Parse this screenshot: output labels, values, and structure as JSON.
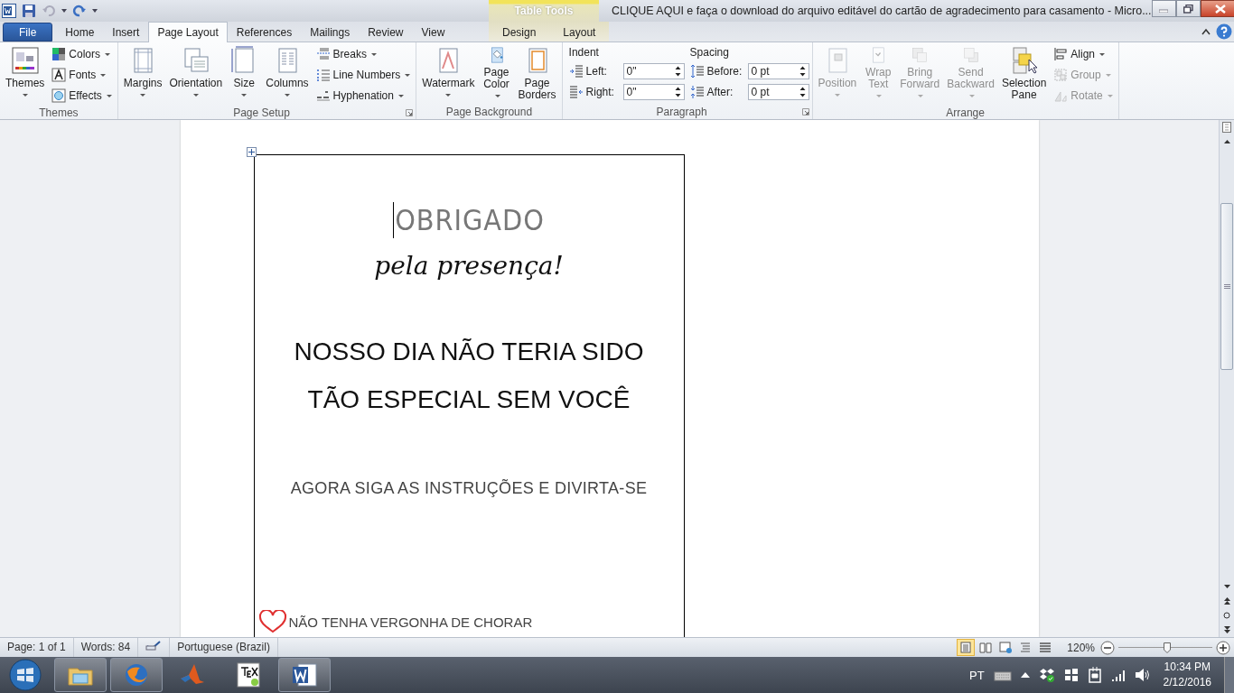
{
  "window": {
    "title": "CLIQUE AQUI e faça o download do arquivo editável do cartão de agradecimento para casamento - Micro...",
    "context_group": "Table Tools"
  },
  "tabs": [
    {
      "label": "File",
      "kind": "file",
      "selected": false
    },
    {
      "label": "Home",
      "kind": "main",
      "selected": false
    },
    {
      "label": "Insert",
      "kind": "main",
      "selected": false
    },
    {
      "label": "Page Layout",
      "kind": "main",
      "selected": true
    },
    {
      "label": "References",
      "kind": "main",
      "selected": false
    },
    {
      "label": "Mailings",
      "kind": "main",
      "selected": false
    },
    {
      "label": "Review",
      "kind": "main",
      "selected": false
    },
    {
      "label": "View",
      "kind": "main",
      "selected": false
    },
    {
      "label": "Design",
      "kind": "contextual",
      "selected": false
    },
    {
      "label": "Layout",
      "kind": "contextual",
      "selected": false
    }
  ],
  "ribbon": {
    "groups": [
      {
        "label": "Themes",
        "launcher": false,
        "columns": [
          [
            {
              "kind": "large",
              "label": "Themes",
              "dropdown": true,
              "disabled": false
            }
          ],
          [
            {
              "kind": "small",
              "label": "Colors",
              "dropdown": true,
              "disabled": false
            },
            {
              "kind": "small",
              "label": "Fonts",
              "dropdown": true,
              "disabled": false
            },
            {
              "kind": "small",
              "label": "Effects",
              "dropdown": true,
              "disabled": false
            }
          ]
        ]
      },
      {
        "label": "Page Setup",
        "launcher": true,
        "columns": [
          [
            {
              "kind": "large",
              "label": "Margins",
              "dropdown": true,
              "disabled": false
            }
          ],
          [
            {
              "kind": "large",
              "label": "Orientation",
              "dropdown": true,
              "disabled": false
            }
          ],
          [
            {
              "kind": "large",
              "label": "Size",
              "dropdown": true,
              "disabled": false
            }
          ],
          [
            {
              "kind": "large",
              "label": "Columns",
              "dropdown": true,
              "disabled": false
            }
          ],
          [
            {
              "kind": "small",
              "label": "Breaks",
              "dropdown": true,
              "disabled": false
            },
            {
              "kind": "small",
              "label": "Line Numbers",
              "dropdown": true,
              "disabled": false
            },
            {
              "kind": "small",
              "label": "Hyphenation",
              "dropdown": true,
              "disabled": false
            }
          ]
        ]
      },
      {
        "label": "Page Background",
        "launcher": false,
        "columns": [
          [
            {
              "kind": "large",
              "label": "Watermark",
              "dropdown": true,
              "disabled": false
            }
          ],
          [
            {
              "kind": "wrap",
              "label": "Page Color",
              "dropdown": true,
              "disabled": false
            }
          ],
          [
            {
              "kind": "wrap",
              "label": "Page Borders",
              "dropdown": false,
              "disabled": false
            }
          ]
        ]
      },
      {
        "label": "Paragraph",
        "launcher": true,
        "columns": [
          [
            {
              "kind": "heading",
              "label": "Indent"
            },
            {
              "kind": "spinner",
              "label": "Left:",
              "value": "0\"",
              "disabled": false
            },
            {
              "kind": "spinner",
              "label": "Right:",
              "value": "0\"",
              "disabled": false
            }
          ],
          [
            {
              "kind": "heading",
              "label": "Spacing"
            },
            {
              "kind": "spinner",
              "label": "Before:",
              "value": "0 pt",
              "disabled": false
            },
            {
              "kind": "spinner",
              "label": "After:",
              "value": "0 pt",
              "disabled": false
            }
          ]
        ]
      },
      {
        "label": "Arrange",
        "launcher": false,
        "columns": [
          [
            {
              "kind": "large",
              "label": "Position",
              "dropdown": true,
              "disabled": true
            }
          ],
          [
            {
              "kind": "wrap",
              "label": "Wrap Text",
              "dropdown": true,
              "disabled": true
            }
          ],
          [
            {
              "kind": "wrap",
              "label": "Bring Forward",
              "dropdown": true,
              "disabled": true
            }
          ],
          [
            {
              "kind": "wrap",
              "label": "Send Backward",
              "dropdown": true,
              "disabled": true
            }
          ],
          [
            {
              "kind": "wrap",
              "label": "Selection Pane",
              "dropdown": false,
              "disabled": false
            }
          ],
          [
            {
              "kind": "small",
              "label": "Align",
              "dropdown": true,
              "disabled": false
            },
            {
              "kind": "small",
              "label": "Group",
              "dropdown": true,
              "disabled": true
            },
            {
              "kind": "small",
              "label": "Rotate",
              "dropdown": true,
              "disabled": true
            }
          ]
        ]
      }
    ]
  },
  "document": {
    "title_line": "OBRIGADO",
    "subtitle": "pela presença!",
    "message": "NOSSO DIA NÃO TERIA SIDO TÃO ESPECIAL SEM VOCÊ",
    "instruction": "AGORA SIGA AS INSTRUÇÕES E DIVIRTA-SE",
    "tip": "NÃO TENHA VERGONHA DE CHORAR"
  },
  "status_bar": {
    "page": "Page: 1 of 1",
    "words": "Words: 84",
    "language": "Portuguese (Brazil)",
    "views": [
      {
        "selected": true
      },
      {
        "selected": false
      },
      {
        "selected": false
      },
      {
        "selected": false
      },
      {
        "selected": false
      }
    ],
    "zoom": "120%",
    "zoom_slider": {
      "level": 0.52
    }
  },
  "taskbar": {
    "apps": [
      {
        "running": true
      },
      {
        "running": true
      },
      {
        "running": false
      },
      {
        "running": false
      },
      {
        "running": true
      }
    ],
    "tray": {
      "language": "PT",
      "time": "10:34 PM",
      "date": "2/12/2016"
    }
  }
}
